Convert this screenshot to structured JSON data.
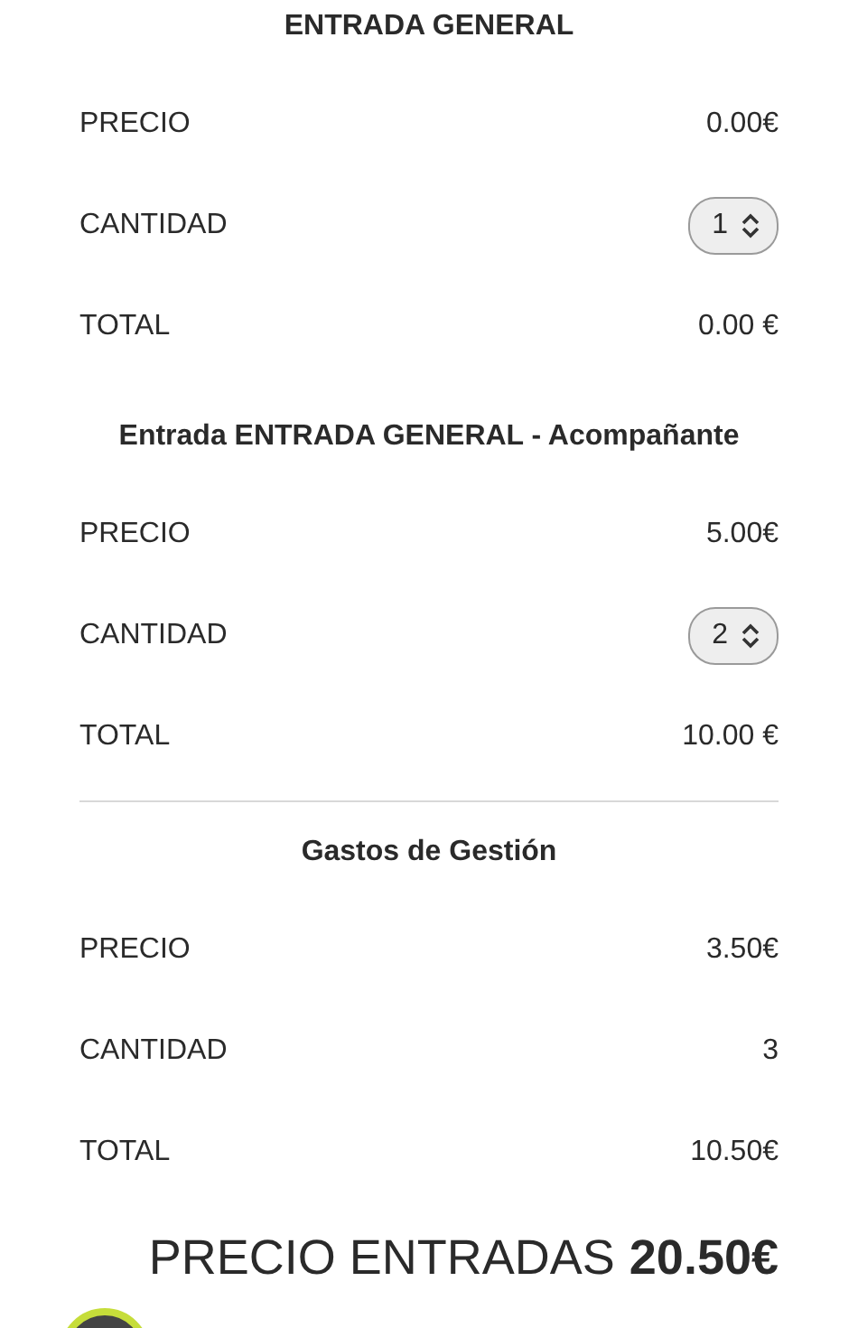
{
  "sections": [
    {
      "title": "ENTRADA GENERAL",
      "separated": false,
      "rows": [
        {
          "kind": "text",
          "label": "PRECIO",
          "value": "0.00€"
        },
        {
          "kind": "stepper",
          "label": "CANTIDAD",
          "value": "1"
        },
        {
          "kind": "text",
          "label": "TOTAL",
          "value": "0.00 €"
        }
      ]
    },
    {
      "title": "Entrada ENTRADA GENERAL - Acompañante",
      "separated": false,
      "rows": [
        {
          "kind": "text",
          "label": "PRECIO",
          "value": "5.00€"
        },
        {
          "kind": "stepper",
          "label": "CANTIDAD",
          "value": "2"
        },
        {
          "kind": "text",
          "label": "TOTAL",
          "value": "10.00 €"
        }
      ]
    },
    {
      "title": "Gastos de Gestión",
      "separated": true,
      "rows": [
        {
          "kind": "text",
          "label": "PRECIO",
          "value": "3.50€"
        },
        {
          "kind": "text",
          "label": "CANTIDAD",
          "value": "3"
        },
        {
          "kind": "text",
          "label": "TOTAL",
          "value": "10.50€"
        }
      ]
    }
  ],
  "summary": {
    "label": "PRECIO ENTRADAS",
    "amount": "20.50€"
  }
}
